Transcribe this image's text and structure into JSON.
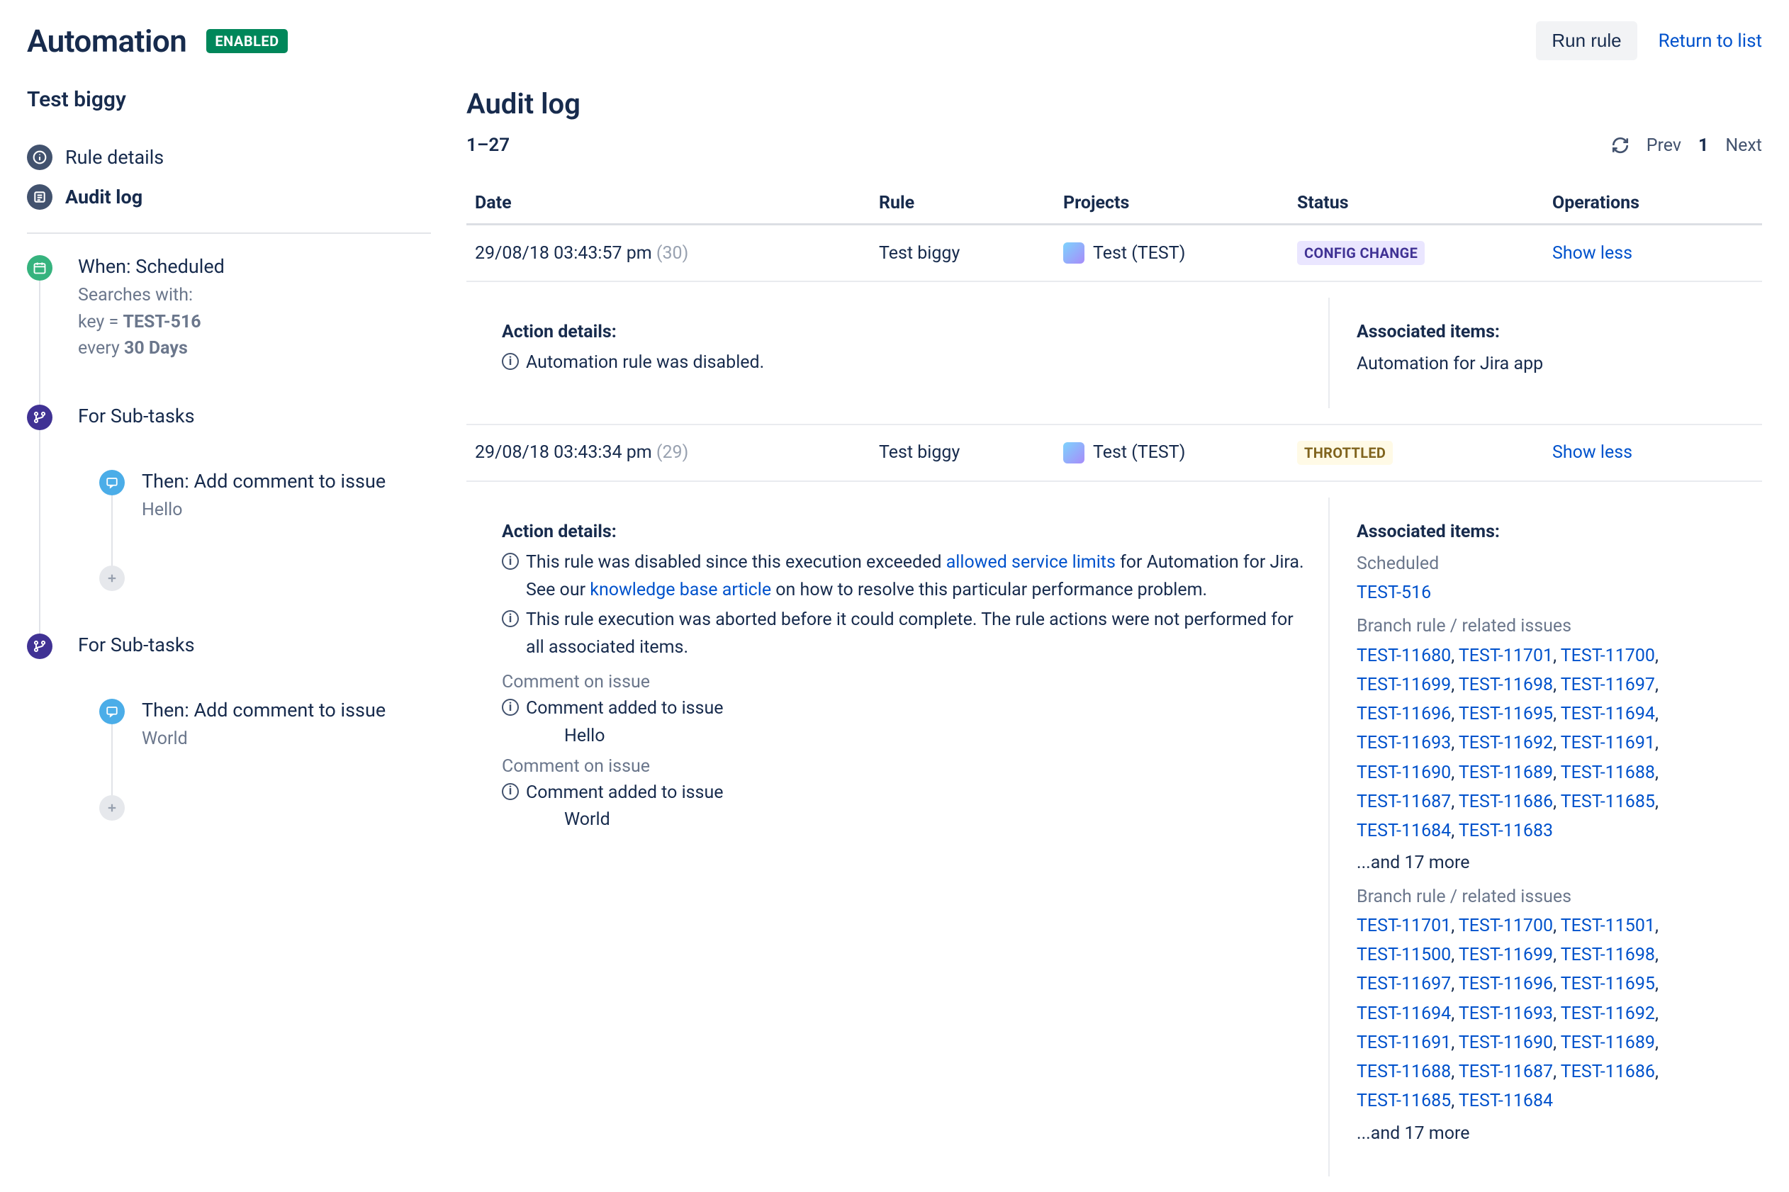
{
  "header": {
    "title": "Automation",
    "status_badge": "ENABLED",
    "run_rule": "Run rule",
    "return": "Return to list"
  },
  "sidebar": {
    "rule_name": "Test biggy",
    "nav": {
      "details": "Rule details",
      "audit": "Audit log"
    },
    "chain": {
      "when_title": "When: Scheduled",
      "when_l1": "Searches with:",
      "when_l2_prefix": "key = ",
      "when_l2_val": "TEST-516",
      "when_l3_prefix": "every ",
      "when_l3_val": "30 Days",
      "branch1_title": "For Sub-tasks",
      "branch1_then": "Then: Add comment to issue",
      "branch1_then_sub": "Hello",
      "branch2_title": "For Sub-tasks",
      "branch2_then": "Then: Add comment to issue",
      "branch2_then_sub": "World"
    }
  },
  "main": {
    "title": "Audit log",
    "range": "1–27",
    "pager": {
      "prev": "Prev",
      "page": "1",
      "next": "Next"
    },
    "cols": {
      "date": "Date",
      "rule": "Rule",
      "projects": "Projects",
      "status": "Status",
      "operations": "Operations"
    },
    "rows": [
      {
        "date": "29/08/18 03:43:57 pm",
        "id": "(30)",
        "rule": "Test biggy",
        "project": "Test (TEST)",
        "status_kind": "config",
        "status": "CONFIG CHANGE",
        "op": "Show less",
        "details": {
          "heading": "Action details:",
          "lines": [
            "Automation rule was disabled."
          ],
          "assoc_heading": "Associated items:",
          "assoc_text": "Automation for Jira app"
        }
      },
      {
        "date": "29/08/18 03:43:34 pm",
        "id": "(29)",
        "rule": "Test biggy",
        "project": "Test (TEST)",
        "status_kind": "throttled",
        "status": "THROTTLED",
        "op": "Show less",
        "details": {
          "heading": "Action details:",
          "line1_a": "This rule was disabled since this execution exceeded ",
          "line1_link1": "allowed service limits",
          "line1_b": " for Automation for Jira. See our ",
          "line1_link2": "knowledge base article",
          "line1_c": " on how to resolve this particular performance problem.",
          "line2": "This rule execution was aborted before it could complete. The rule actions were not performed for all associated items.",
          "comment_section": "Comment on issue",
          "comment_added": "Comment added to issue",
          "comment1_val": "Hello",
          "comment2_val": "World",
          "assoc_heading": "Associated items:",
          "scheduled_label": "Scheduled",
          "scheduled_link": "TEST-516",
          "branch_label": "Branch rule / related issues",
          "branch1_links": [
            "TEST-11680",
            "TEST-11701",
            "TEST-11700",
            "TEST-11699",
            "TEST-11698",
            "TEST-11697",
            "TEST-11696",
            "TEST-11695",
            "TEST-11694",
            "TEST-11693",
            "TEST-11692",
            "TEST-11691",
            "TEST-11690",
            "TEST-11689",
            "TEST-11688",
            "TEST-11687",
            "TEST-11686",
            "TEST-11685",
            "TEST-11684",
            "TEST-11683"
          ],
          "branch1_more": "...and 17 more",
          "branch2_links": [
            "TEST-11701",
            "TEST-11700",
            "TEST-11501",
            "TEST-11500",
            "TEST-11699",
            "TEST-11698",
            "TEST-11697",
            "TEST-11696",
            "TEST-11695",
            "TEST-11694",
            "TEST-11693",
            "TEST-11692",
            "TEST-11691",
            "TEST-11690",
            "TEST-11689",
            "TEST-11688",
            "TEST-11687",
            "TEST-11686",
            "TEST-11685",
            "TEST-11684"
          ],
          "branch2_more": "...and 17 more"
        }
      }
    ]
  }
}
